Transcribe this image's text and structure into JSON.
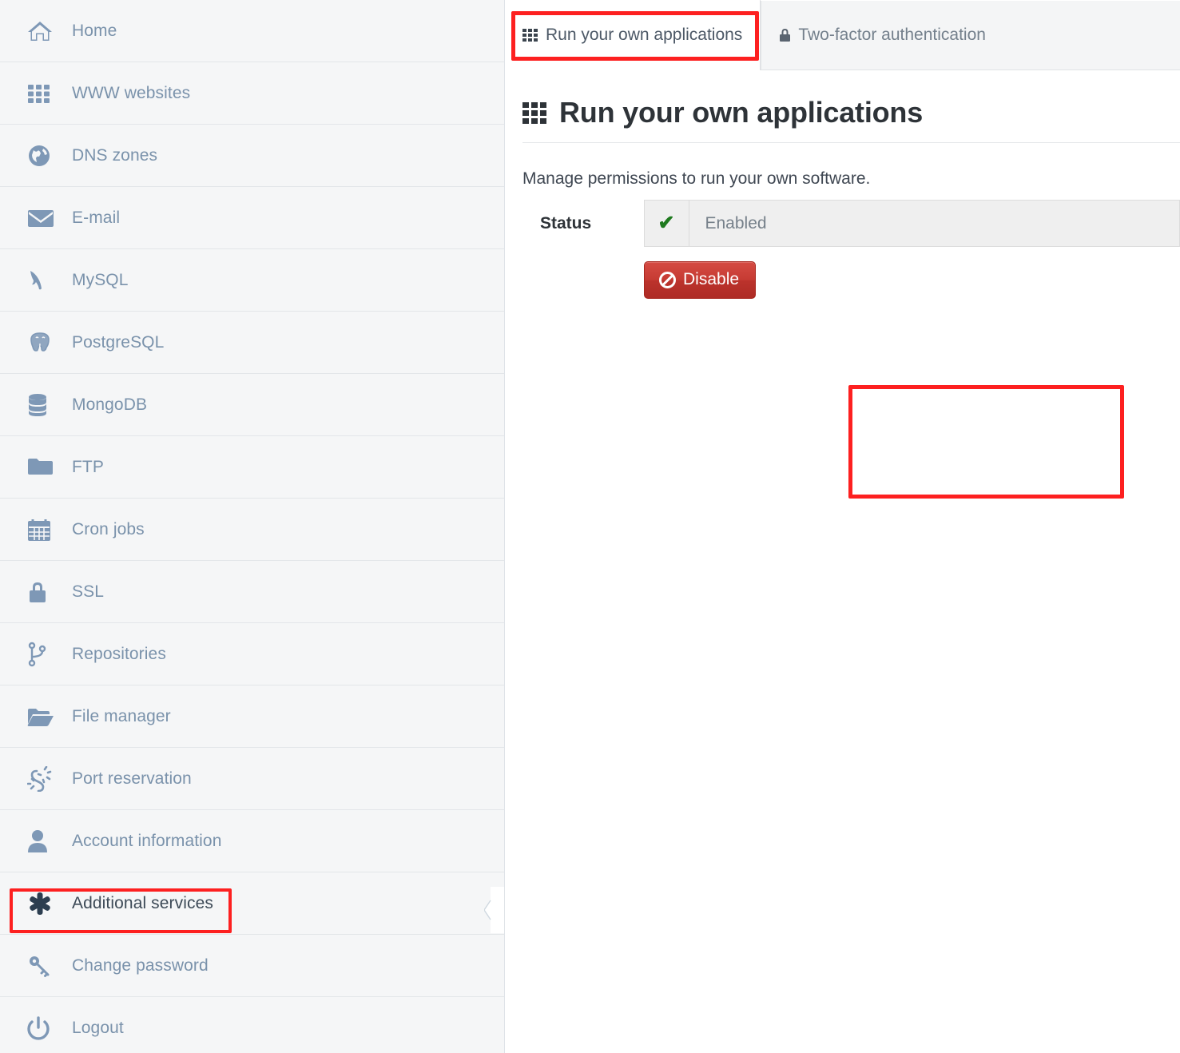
{
  "sidebar": {
    "items": [
      {
        "label": "Home",
        "icon": "home-icon",
        "active": false
      },
      {
        "label": "WWW websites",
        "icon": "grid-icon",
        "active": false
      },
      {
        "label": "DNS zones",
        "icon": "globe-icon",
        "active": false
      },
      {
        "label": "E-mail",
        "icon": "envelope-icon",
        "active": false
      },
      {
        "label": "MySQL",
        "icon": "dolphin-icon",
        "active": false
      },
      {
        "label": "PostgreSQL",
        "icon": "elephant-icon",
        "active": false
      },
      {
        "label": "MongoDB",
        "icon": "database-icon",
        "active": false
      },
      {
        "label": "FTP",
        "icon": "folder-icon",
        "active": false
      },
      {
        "label": "Cron jobs",
        "icon": "calendar-icon",
        "active": false
      },
      {
        "label": "SSL",
        "icon": "lock-icon",
        "active": false
      },
      {
        "label": "Repositories",
        "icon": "code-branch-icon",
        "active": false
      },
      {
        "label": "File manager",
        "icon": "folder-open-icon",
        "active": false
      },
      {
        "label": "Port reservation",
        "icon": "plug-icon",
        "active": false
      },
      {
        "label": "Account information",
        "icon": "user-icon",
        "active": false
      },
      {
        "label": "Additional services",
        "icon": "asterisk-icon",
        "active": true
      },
      {
        "label": "Change password",
        "icon": "key-icon",
        "active": false
      },
      {
        "label": "Logout",
        "icon": "power-icon",
        "active": false
      }
    ]
  },
  "tabs": [
    {
      "label": "Run your own applications",
      "icon": "grid-icon",
      "active": true
    },
    {
      "label": "Two-factor authentication",
      "icon": "lock-icon",
      "active": false
    }
  ],
  "main": {
    "title": "Run your own applications",
    "title_icon": "grid-icon",
    "description": "Manage permissions to run your own software."
  },
  "status": {
    "label": "Status",
    "check_icon": "check-icon",
    "value": "Enabled",
    "button_label": "Disable",
    "button_icon": "ban-icon"
  },
  "colors": {
    "highlight": "#fd2020",
    "sidebar_bg": "#f5f6f7",
    "nav_text": "#7a92ab",
    "danger": "#c63b33",
    "check_green": "#1f7a1f"
  }
}
